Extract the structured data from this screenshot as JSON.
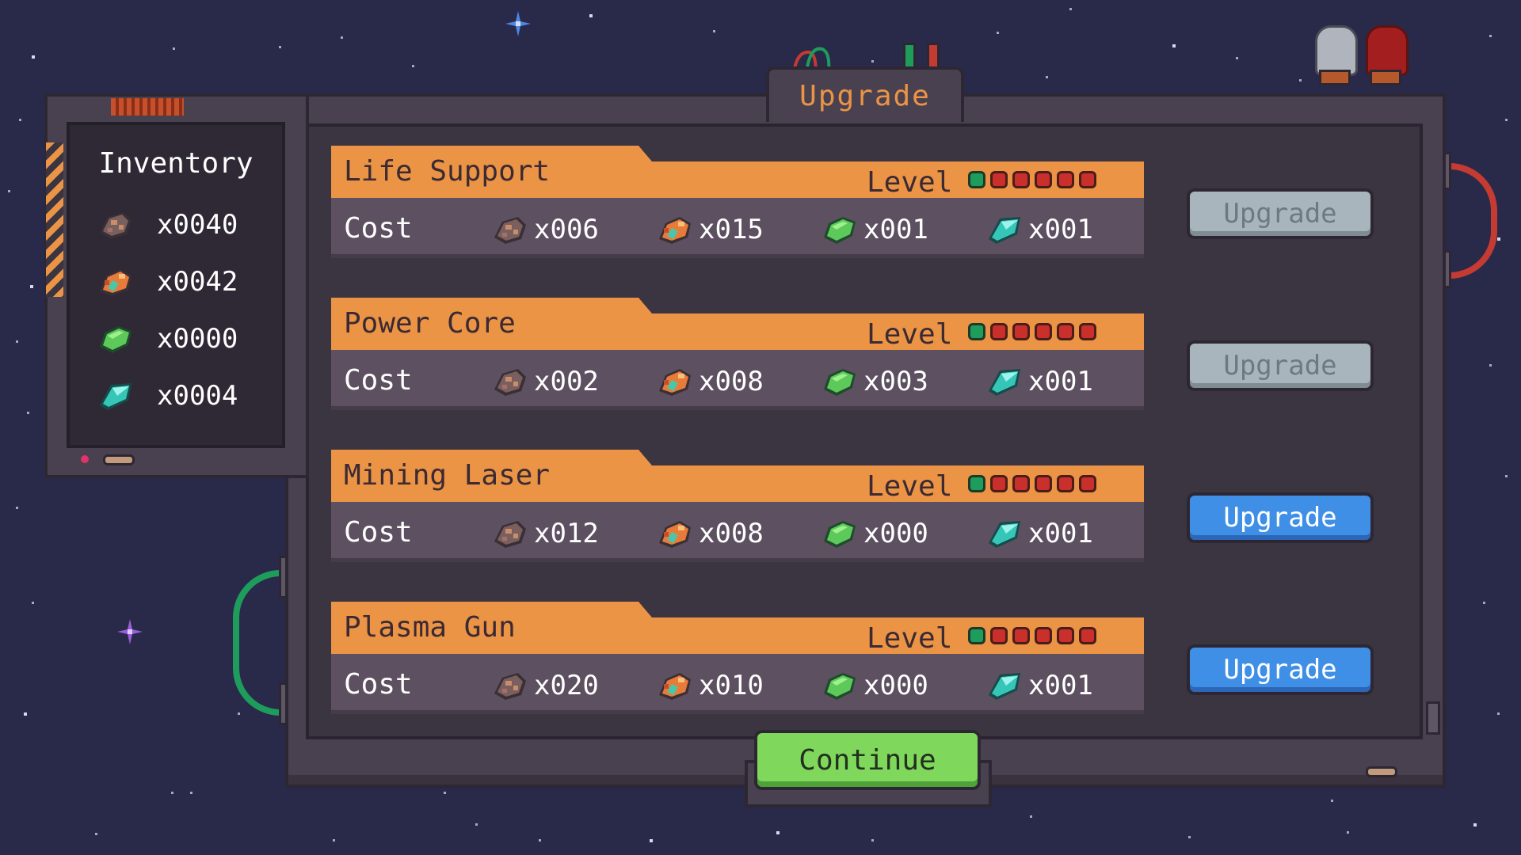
{
  "title": "Upgrade",
  "inventory": {
    "title": "Inventory",
    "items": [
      {
        "resource": "rock-ore",
        "quantity": "x0040"
      },
      {
        "resource": "copper-ore",
        "quantity": "x0042"
      },
      {
        "resource": "green-gem",
        "quantity": "x0000"
      },
      {
        "resource": "cyan-crystal",
        "quantity": "x0004"
      }
    ]
  },
  "labels": {
    "level": "Level",
    "cost": "Cost"
  },
  "upgrades": [
    {
      "name": "Life Support",
      "level": 1,
      "max_level": 6,
      "costs": [
        "x006",
        "x015",
        "x001",
        "x001"
      ],
      "button": "Upgrade",
      "enabled": false
    },
    {
      "name": "Power Core",
      "level": 1,
      "max_level": 6,
      "costs": [
        "x002",
        "x008",
        "x003",
        "x001"
      ],
      "button": "Upgrade",
      "enabled": false
    },
    {
      "name": "Mining Laser",
      "level": 1,
      "max_level": 6,
      "costs": [
        "x012",
        "x008",
        "x000",
        "x001"
      ],
      "button": "Upgrade",
      "enabled": true
    },
    {
      "name": "Plasma Gun",
      "level": 1,
      "max_level": 6,
      "costs": [
        "x020",
        "x010",
        "x000",
        "x001"
      ],
      "button": "Upgrade",
      "enabled": true
    }
  ],
  "continue_label": "Continue",
  "colors": {
    "background": "#29294a",
    "accent_orange": "#eb9445",
    "button_blue": "#3f8fe6",
    "button_disabled": "#a9b5bd",
    "continue_green": "#7fd75b",
    "level_on": "#1e9c5c",
    "level_off": "#c9302c"
  }
}
